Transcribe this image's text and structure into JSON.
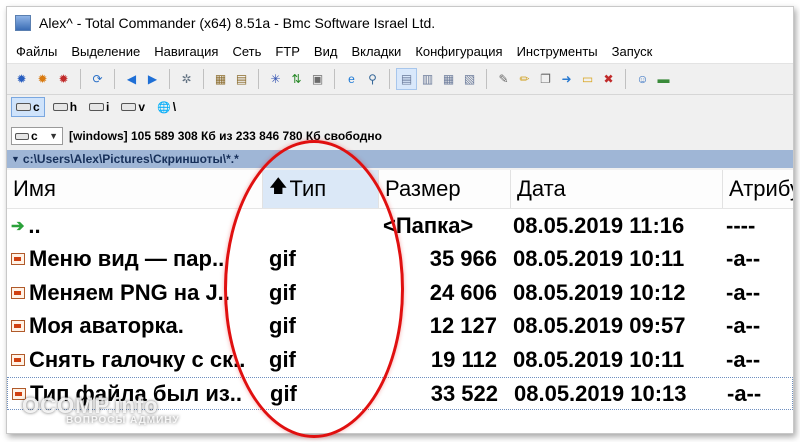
{
  "window": {
    "title": "Alex^ - Total Commander (x64) 8.51a - Bmc Software Israel Ltd."
  },
  "menu": {
    "items": [
      "Файлы",
      "Выделение",
      "Навигация",
      "Сеть",
      "FTP",
      "Вид",
      "Вкладки",
      "Конфигурация",
      "Инструменты",
      "Запуск"
    ]
  },
  "toolbar": {
    "groups": [
      [
        "gear-blue-icon",
        "gear-orange-icon",
        "gear-red-icon"
      ],
      [
        "refresh-icon"
      ],
      [
        "arrow-left-icon",
        "arrow-right-icon"
      ],
      [
        "gear-gray-icon"
      ],
      [
        "pack-icon",
        "unpack-icon"
      ],
      [
        "asterisk-icon",
        "sort-az-icon",
        "clipboard-icon"
      ],
      [
        "ie-icon",
        "ftp-icon"
      ],
      [
        "view-brief-icon",
        "view-full-icon",
        "view-thumbs-icon",
        "view-tree-icon"
      ],
      [
        "edit-icon",
        "pencil-icon",
        "copy-icon",
        "move-icon",
        "newfolder-icon",
        "delete-icon"
      ],
      [
        "users-icon",
        "monitor-icon"
      ]
    ],
    "glyphs": {
      "gear-blue-icon": "✹",
      "gear-orange-icon": "✹",
      "gear-red-icon": "✹",
      "refresh-icon": "⟳",
      "arrow-left-icon": "◀",
      "arrow-right-icon": "▶",
      "gear-gray-icon": "✲",
      "pack-icon": "▦",
      "unpack-icon": "▤",
      "asterisk-icon": "✳",
      "sort-az-icon": "⇅",
      "clipboard-icon": "▣",
      "ie-icon": "e",
      "ftp-icon": "⚲",
      "view-brief-icon": "▤",
      "view-full-icon": "▥",
      "view-thumbs-icon": "▦",
      "view-tree-icon": "▧",
      "edit-icon": "✎",
      "pencil-icon": "✏",
      "copy-icon": "❐",
      "move-icon": "➜",
      "newfolder-icon": "▭",
      "delete-icon": "✖",
      "users-icon": "☺",
      "monitor-icon": "▬"
    },
    "colors": {
      "gear-blue-icon": "#2a5fc0",
      "gear-orange-icon": "#d97a10",
      "gear-red-icon": "#c02a2a",
      "refresh-icon": "#2a70c8",
      "arrow-left-icon": "#1e6fd6",
      "arrow-right-icon": "#1e6fd6",
      "gear-gray-icon": "#607080",
      "pack-icon": "#8a6a2a",
      "unpack-icon": "#8a6a2a",
      "asterisk-icon": "#3050b0",
      "sort-az-icon": "#2a8a2a",
      "clipboard-icon": "#6a6a6a",
      "ie-icon": "#1e7ad6",
      "ftp-icon": "#3a6a9a",
      "view-brief-icon": "#6a7a9a",
      "view-full-icon": "#6a7a9a",
      "view-thumbs-icon": "#6a7a9a",
      "view-tree-icon": "#6a7a9a",
      "edit-icon": "#6a6a6a",
      "pencil-icon": "#d0a020",
      "copy-icon": "#6a6a6a",
      "move-icon": "#2a7ad0",
      "newfolder-icon": "#d9a520",
      "delete-icon": "#c02a2a",
      "users-icon": "#2a6ac0",
      "monitor-icon": "#3a8a3a"
    }
  },
  "drives": [
    {
      "letter": "c",
      "active": true
    },
    {
      "letter": "h",
      "active": false
    },
    {
      "letter": "i",
      "active": false
    },
    {
      "letter": "v",
      "active": false
    },
    {
      "letter": "\\",
      "active": false
    }
  ],
  "path_info": {
    "drive": "c",
    "free_space": "[windows]  105 589 308 Кб из 233 846 780 Кб свободно"
  },
  "path_bar": {
    "path": "c:\\Users\\Alex\\Pictures\\Скриншоты\\*.*"
  },
  "columns": {
    "name": "Имя",
    "ext": "Тип",
    "size": "Размер",
    "date": "Дата",
    "attr": "Атрибуты"
  },
  "files": [
    {
      "name": "..",
      "ext": "",
      "size": "<Папка>",
      "date": "08.05.2019 11:16",
      "attr": "----",
      "type": "up"
    },
    {
      "name": "Меню вид — пар..",
      "ext": "gif",
      "size": "35 966",
      "date": "08.05.2019 10:11",
      "attr": "-a--",
      "type": "file"
    },
    {
      "name": "Меняем PNG на J..",
      "ext": "gif",
      "size": "24 606",
      "date": "08.05.2019 10:12",
      "attr": "-a--",
      "type": "file"
    },
    {
      "name": "Моя аваторка.",
      "ext": "gif",
      "size": "12 127",
      "date": "08.05.2019 09:57",
      "attr": "-a--",
      "type": "file"
    },
    {
      "name": "Снять галочку с ск..",
      "ext": "gif",
      "size": "19 112",
      "date": "08.05.2019 10:11",
      "attr": "-a--",
      "type": "file"
    },
    {
      "name": "Тип файла был из..",
      "ext": "gif",
      "size": "33 522",
      "date": "08.05.2019 10:13",
      "attr": "-a--",
      "type": "file"
    }
  ],
  "watermark": {
    "main": "OCOMP.info",
    "sub": "ВОПРОСЫ АДМИНУ"
  }
}
